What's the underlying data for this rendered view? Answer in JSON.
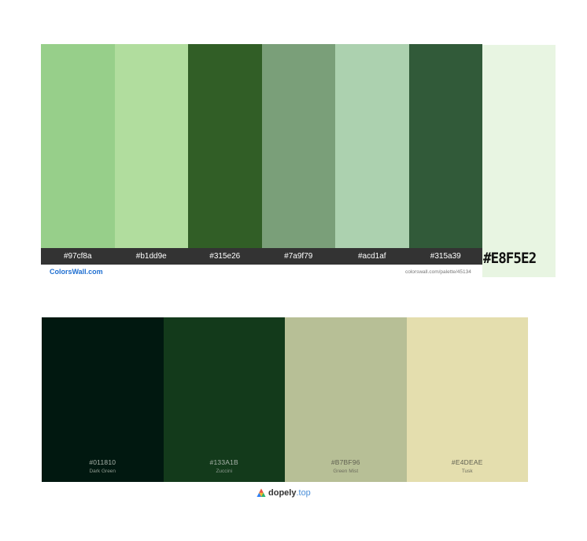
{
  "colorswall": {
    "swatches": [
      {
        "color": "#97cf8a",
        "label": "#97cf8a"
      },
      {
        "color": "#b1dd9e",
        "label": "#b1dd9e"
      },
      {
        "color": "#315e26",
        "label": "#315e26"
      },
      {
        "color": "#7a9f79",
        "label": "#7a9f79"
      },
      {
        "color": "#acd1af",
        "label": "#acd1af"
      },
      {
        "color": "#315a39",
        "label": "#315a39"
      }
    ],
    "extra_swatch": {
      "color": "#E8F5E2",
      "label": "#E8F5E2"
    },
    "brand": "ColorsWall.com",
    "url": "colorswall.com/palette/45134"
  },
  "dopely": {
    "swatches": [
      {
        "color": "#011810",
        "hex": "#011810",
        "name": "Dark Green",
        "tone": "dark"
      },
      {
        "color": "#133A1B",
        "hex": "#133A1B",
        "name": "Zuccini",
        "tone": "dark"
      },
      {
        "color": "#B7BF96",
        "hex": "#B7BF96",
        "name": "Green Mist",
        "tone": "light"
      },
      {
        "color": "#E4DEAE",
        "hex": "#E4DEAE",
        "name": "Tusk",
        "tone": "light"
      }
    ],
    "brand_name": "dopely",
    "brand_tld": ".top",
    "logo_icon": "dopely-logo-icon"
  }
}
